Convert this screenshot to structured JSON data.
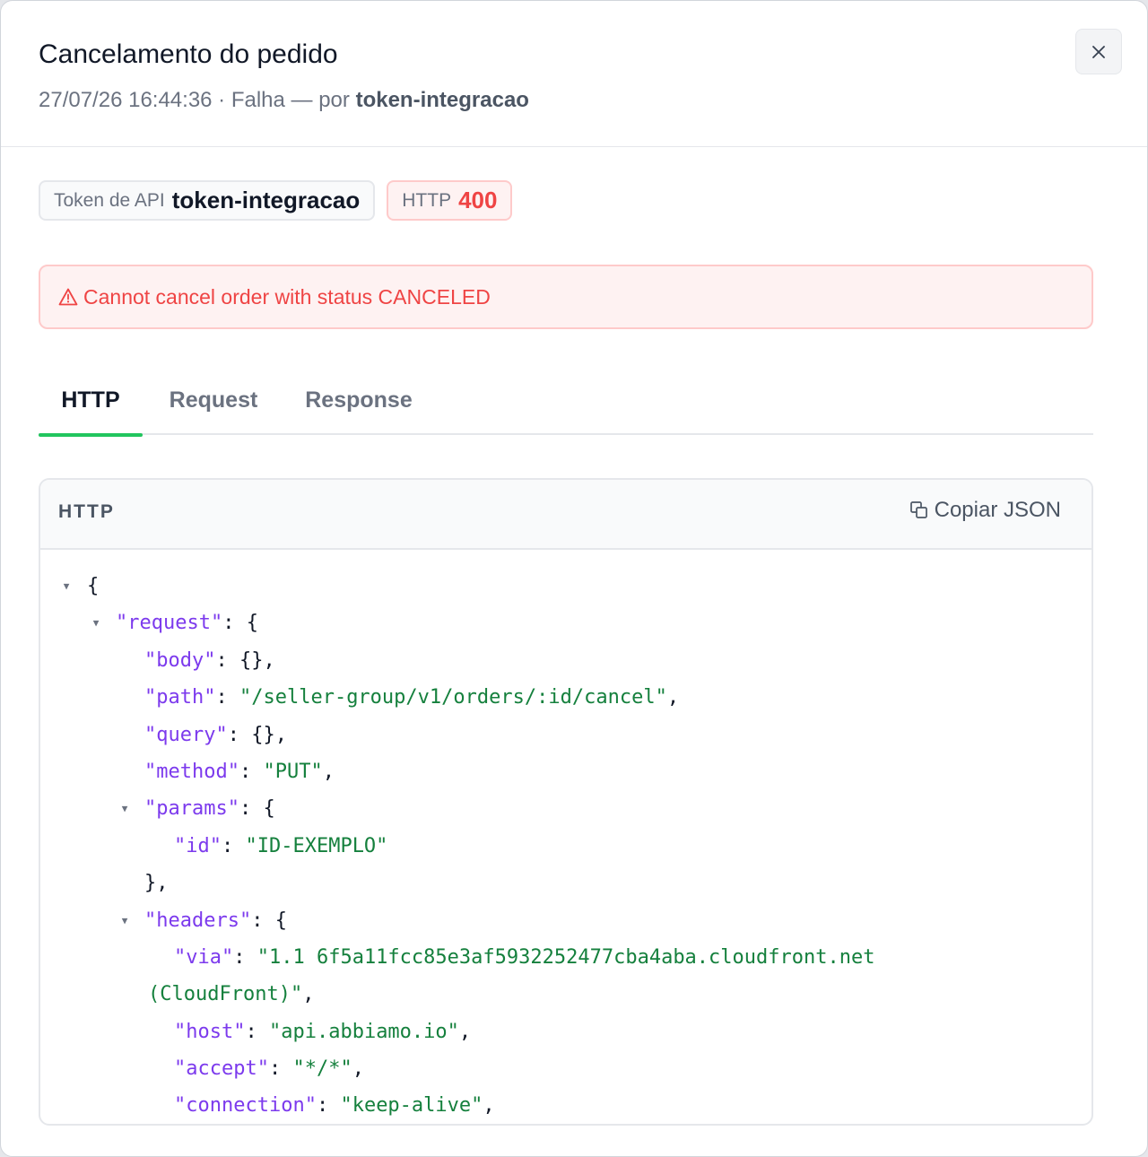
{
  "modal": {
    "title": "Cancelamento do pedido",
    "meta": "27/07/26 16:44:36 · Falha — por",
    "actor": "token-integracao"
  },
  "badges": {
    "token_label": "Token de API",
    "token_value": "token-integracao",
    "http_label": "HTTP",
    "http_value": "400"
  },
  "alert": {
    "message": "Cannot cancel order with status CANCELED"
  },
  "tabs": [
    {
      "label": "HTTP",
      "active": true
    },
    {
      "label": "Request",
      "active": false
    },
    {
      "label": "Response",
      "active": false
    }
  ],
  "panel": {
    "title": "HTTP",
    "copy_label": "Copiar JSON"
  },
  "json": {
    "k_request": "\"request\"",
    "k_body": "\"body\"",
    "k_path": "\"path\"",
    "v_path": "\"/seller-group/v1/orders/:id/cancel\"",
    "k_query": "\"query\"",
    "k_method": "\"method\"",
    "v_method": "\"PUT\"",
    "k_params": "\"params\"",
    "k_id": "\"id\"",
    "v_id": "\"ID-EXEMPLO\"",
    "k_headers": "\"headers\"",
    "k_via": "\"via\"",
    "v_via_1": "\"1.1 6f5a11fcc85e3af5932252477cba4aba.cloudfront.net",
    "v_via_2": "(CloudFront)\"",
    "k_host": "\"host\"",
    "v_host": "\"api.abbiamo.io\"",
    "k_accept": "\"accept\"",
    "v_accept": "\"*/*\"",
    "k_connection": "\"connection\"",
    "v_connection": "\"keep-alive\""
  },
  "colors": {
    "accent": "#22c55e",
    "error": "#ef4444",
    "json_key": "#7c3aed",
    "json_string": "#15803d"
  },
  "icons": {
    "close": "close-icon",
    "alert": "warning-triangle-icon",
    "copy": "copy-icon",
    "toggle": "triangle-down-icon"
  }
}
